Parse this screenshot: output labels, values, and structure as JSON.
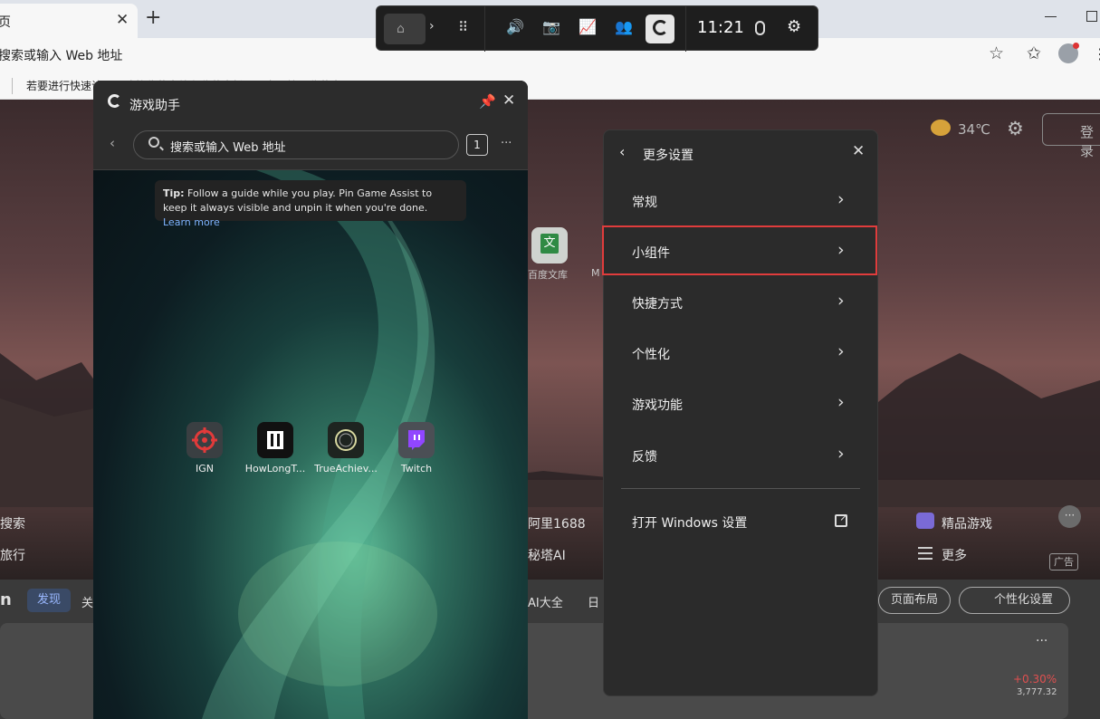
{
  "browser": {
    "tab_title": "页",
    "tab_close": "✕",
    "new_tab": "+",
    "address_text": "搜索或输入 Web 地址",
    "bookmark_text": "若要进行快速访问，请将收藏夹放在收藏夹栏上。立即管理收藏夹",
    "star": "☆",
    "favorites": "✩",
    "more": "⋮"
  },
  "page": {
    "weather_temp": "34℃",
    "login": "登录",
    "gear": "⚙",
    "wenku_label": "百度文库",
    "wenku_glyph": "文",
    "m_label": "M",
    "row1": [
      {
        "label": "搜索"
      },
      {
        "label": "阿里1688"
      },
      {
        "label": "精品游戏"
      }
    ],
    "row2": [
      {
        "label": "旅行"
      },
      {
        "label": "秘塔AI"
      },
      {
        "label": "更多"
      }
    ],
    "ad": "广告",
    "more_dots": "···",
    "feed_tabs": {
      "left_letter": "n",
      "discover": "发现",
      "follow": "关",
      "ai": "AI大全",
      "daily": "日"
    },
    "layout_btn": "页面布局",
    "personalize_btn": "个性化设置",
    "stock_change": "+0.30%",
    "stock_value": "3,777.32",
    "stock_more": "···"
  },
  "gamebar": {
    "time": "11:21",
    "chevron": "›",
    "grid": "⠿",
    "volume": "🔊",
    "camera": "📷",
    "performance": "📈",
    "social": "👥",
    "settings": "⚙"
  },
  "assist": {
    "title": "游戏助手",
    "pin": "📌",
    "close": "✕",
    "back": "‹",
    "search_placeholder": "搜索或输入 Web 地址",
    "tab_count": "1",
    "more": "···",
    "tip_bold": "Tip:",
    "tip_text": " Follow a guide while you play. Pin Game Assist to keep it always visible and unpin it when you're done. ",
    "tip_link": "Learn more",
    "sites": [
      {
        "label": "IGN"
      },
      {
        "label": "HowLongT..."
      },
      {
        "label": "TrueAchiev..."
      },
      {
        "label": "Twitch"
      }
    ]
  },
  "settings": {
    "back": "‹",
    "title": "更多设置",
    "close": "✕",
    "items": [
      {
        "label": "常规"
      },
      {
        "label": "小组件"
      },
      {
        "label": "快捷方式"
      },
      {
        "label": "个性化"
      },
      {
        "label": "游戏功能"
      },
      {
        "label": "反馈"
      }
    ],
    "chevron": "›",
    "open_windows": "打开 Windows 设置"
  },
  "colors": {
    "highlight": "#e03c3c",
    "link": "#7fb4ff",
    "accent_discover": "#9ab8ff"
  }
}
